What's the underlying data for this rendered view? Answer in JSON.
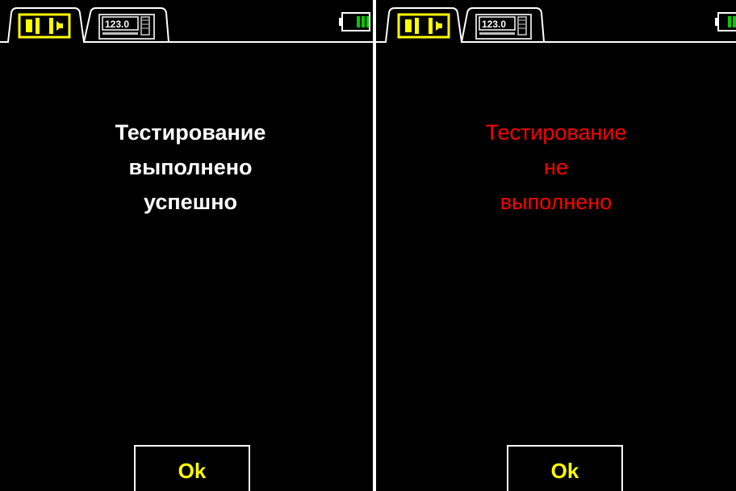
{
  "screens": [
    {
      "status": "success",
      "message_lines": [
        "Тестирование",
        "выполнено",
        "успешно"
      ],
      "message_color": "#ffffff",
      "ok_label": "Ok"
    },
    {
      "status": "failure",
      "message_lines": [
        "Тестирование",
        "не",
        "выполнено"
      ],
      "message_color": "#ff0000",
      "ok_label": "Ok"
    }
  ],
  "tabs": [
    {
      "icon": "align-gap-icon",
      "active": true
    },
    {
      "icon": "numeric-display-icon",
      "active": false
    }
  ],
  "battery": {
    "icon": "battery-icon",
    "level_color": "#00cc00"
  },
  "colors": {
    "background": "#000000",
    "accent": "#ffff00",
    "frame": "#ffffff",
    "error": "#ff0000"
  }
}
